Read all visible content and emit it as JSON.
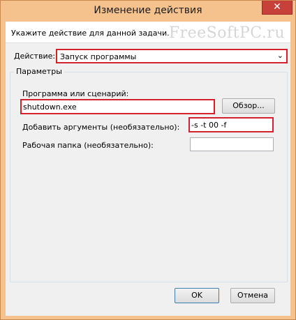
{
  "window": {
    "title": "Изменение действия",
    "close_glyph": "✕"
  },
  "header": {
    "instruction": "Укажите действие для данной задачи.",
    "watermark": "FreeSoftPC.ru"
  },
  "action": {
    "label": "Действие:",
    "selected": "Запуск программы"
  },
  "params": {
    "title": "Параметры",
    "program_label": "Программа или сценарий:",
    "program_value": "shutdown.exe",
    "browse_label": "Обзор...",
    "args_label": "Добавить аргументы (необязательно):",
    "args_value": "-s -t 00 -f",
    "dir_label": "Рабочая папка (необязательно):",
    "dir_value": ""
  },
  "buttons": {
    "ok": "OK",
    "cancel": "Отмена"
  },
  "colors": {
    "frame": "#f5c18d",
    "highlight": "#d2232a",
    "close": "#c7413a"
  }
}
